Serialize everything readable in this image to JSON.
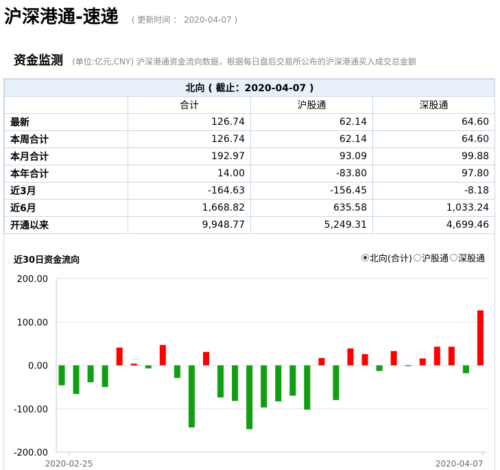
{
  "header": {
    "title": "沪深港通-速递",
    "update_text": "( 更新时间 ： 2020-04-07 )"
  },
  "section": {
    "title": "资金监测",
    "description": "(单位:亿元,CNY)   沪深港通资金流向数据，根据每日盘后交易所公布的沪深港通买入成交总金额"
  },
  "table": {
    "caption": "北向 ( 截止：2020-04-07 )",
    "columns": [
      "",
      "合计",
      "沪股通",
      "深股通"
    ],
    "rows": [
      {
        "label": "最新",
        "total": "126.74",
        "sh": "62.14",
        "sz": "64.60"
      },
      {
        "label": "本周合计",
        "total": "126.74",
        "sh": "62.14",
        "sz": "64.60"
      },
      {
        "label": "本月合计",
        "total": "192.97",
        "sh": "93.09",
        "sz": "99.88"
      },
      {
        "label": "本年合计",
        "total": "14.00",
        "sh": "-83.80",
        "sz": "97.80"
      },
      {
        "label": "近3月",
        "total": "-164.63",
        "sh": "-156.45",
        "sz": "-8.18"
      },
      {
        "label": "近6月",
        "total": "1,668.82",
        "sh": "635.58",
        "sz": "1,033.24"
      },
      {
        "label": "开通以来",
        "total": "9,948.77",
        "sh": "5,249.31",
        "sz": "4,699.46"
      }
    ]
  },
  "chart_section": {
    "title": "近30日资金流向",
    "options": [
      {
        "label": "北向(合计)",
        "selected": true
      },
      {
        "label": "沪股通",
        "selected": false
      },
      {
        "label": "深股通",
        "selected": false
      }
    ]
  },
  "chart_data": {
    "type": "bar",
    "ylim": [
      -200,
      200
    ],
    "yticks": [
      200,
      100,
      0,
      -100,
      -200
    ],
    "ytick_labels": [
      "200.00",
      "100.00",
      "0.00",
      "-100.00",
      "-200.00"
    ],
    "x_first_label": "2020-02-25",
    "x_last_label": "2020-04-07",
    "values": [
      -46,
      -66,
      -39,
      -50,
      41,
      4,
      -7,
      47,
      -29,
      -143,
      31,
      -74,
      -82,
      -147,
      -97,
      -83,
      -70,
      -102,
      17,
      -80,
      39,
      26,
      -13,
      33,
      -2,
      16,
      43,
      43,
      -18,
      126.74
    ],
    "colors": {
      "positive": "#ff0000",
      "negative": "#119f11",
      "grid": "#dde3ea",
      "axis": "#c0c8d2"
    }
  }
}
